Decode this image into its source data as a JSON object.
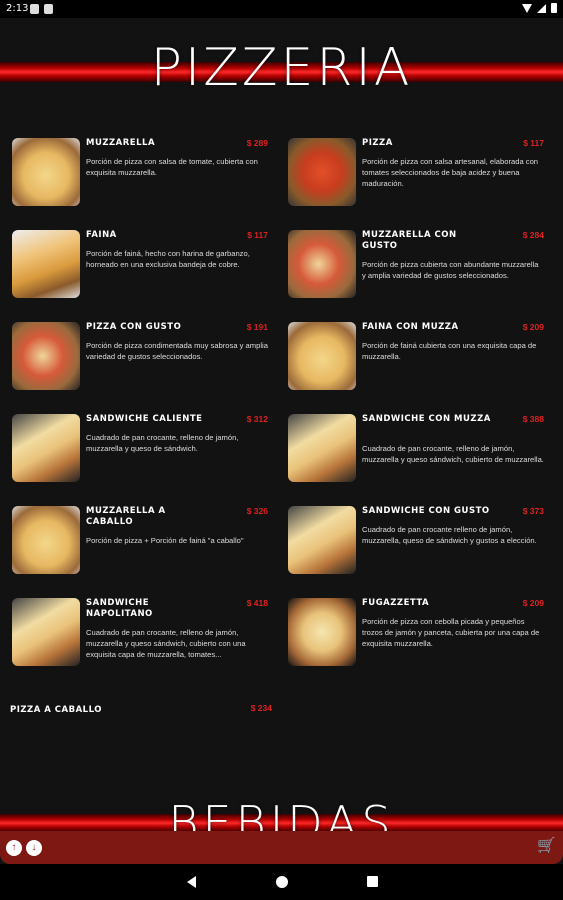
{
  "status": {
    "time": "2:13"
  },
  "sections": {
    "pizzeria_title": "PIZZERIA",
    "bebidas_title": "BEBIDAS"
  },
  "items": [
    {
      "name": "MUZZARELLA",
      "price": "$ 289",
      "desc": "Porción de pizza con salsa de tomate, cubierta con exquisita muzzarella."
    },
    {
      "name": "PIZZA",
      "price": "$ 117",
      "desc": "Porción de pizza con salsa artesanal, elaborada con tomates seleccionados de baja acidez y buena maduración."
    },
    {
      "name": "FAINA",
      "price": "$ 117",
      "desc": "Porción de fainá, hecho con harina de garbanzo, horneado en una exclusiva bandeja de cobre."
    },
    {
      "name": "MUZZARELLA CON GUSTO",
      "price": "$ 284",
      "desc": "Porción de pizza cubierta con abundante muzzarella y amplia variedad de gustos seleccionados."
    },
    {
      "name": "PIZZA CON GUSTO",
      "price": "$ 191",
      "desc": "Porción de pizza condimentada muy sabrosa y amplia variedad de gustos seleccionados."
    },
    {
      "name": "FAINA CON MUZZA",
      "price": "$ 209",
      "desc": "Porción de fainá cubierta con una exquisita capa de muzzarella."
    },
    {
      "name": "SANDWICHE CALIENTE",
      "price": "$ 312",
      "desc": "Cuadrado de pan crocante, relleno de jamón, muzzarella y queso de sándwich."
    },
    {
      "name": "SANDWICHE CON MUZZA",
      "price": "$ 388",
      "desc": "Cuadrado de pan crocante, relleno de jamón, muzzarella y queso sándwich, cubierto de muzzarella."
    },
    {
      "name": "MUZZARELLA A CABALLO",
      "price": "$ 326",
      "desc": "Porción de pizza + Porción de fainá \"a caballo\""
    },
    {
      "name": "SANDWICHE CON GUSTO",
      "price": "$ 373",
      "desc": "Cuadrado de pan crocante relleno de jamón, muzzarella, queso de sándwich y gustos a elección."
    },
    {
      "name": "SANDWICHE NAPOLITANO",
      "price": "$ 418",
      "desc": "Cuadrado de pan crocante, relleno de jamón, muzzarella y queso sándwich, cubierto con una exquisita capa de muzzarella, tomates..."
    },
    {
      "name": "FUGAZZETTA",
      "price": "$ 209",
      "desc": "Porción de pizza con cebolla picada y pequeños trozos de jamón y panceta, cubierta por una capa de exquisita muzzarella."
    }
  ],
  "extra_item": {
    "name": "PIZZA A CABALLO",
    "price": "$ 234"
  },
  "icons": {
    "scroll_up": "arrow-up-icon",
    "scroll_down": "arrow-down-icon",
    "cart": "cart-icon"
  },
  "colors": {
    "accent": "#e02020",
    "bar": "#7e1812",
    "background": "#121212"
  }
}
